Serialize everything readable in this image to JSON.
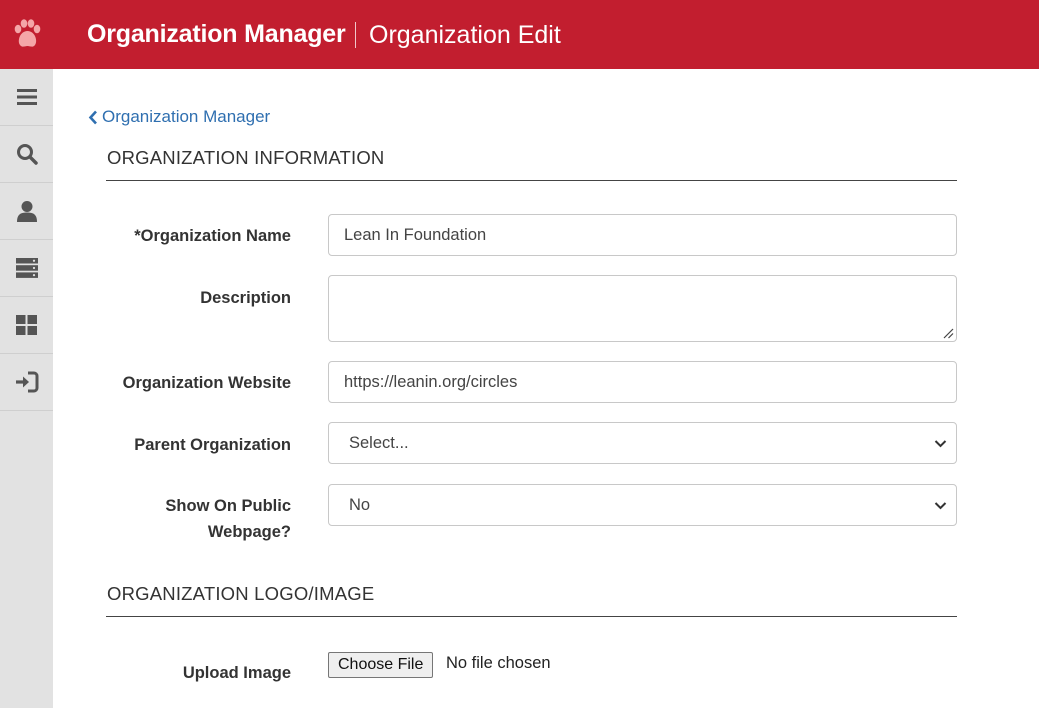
{
  "header": {
    "app_title": "Organization Manager",
    "page_title": "Organization Edit",
    "brand_color": "#c21e2f",
    "logo_icon": "paw-icon"
  },
  "sidebar": {
    "items": [
      {
        "icon": "menu-icon"
      },
      {
        "icon": "search-icon"
      },
      {
        "icon": "user-icon"
      },
      {
        "icon": "server-icon"
      },
      {
        "icon": "dashboard-icon"
      },
      {
        "icon": "sign-in-icon"
      }
    ]
  },
  "breadcrumb": {
    "back_label": "Organization Manager"
  },
  "sections": {
    "info_heading": "ORGANIZATION INFORMATION",
    "logo_heading": "ORGANIZATION LOGO/IMAGE"
  },
  "form": {
    "name_label": "*Organization Name",
    "name_value": "Lean In Foundation",
    "description_label": "Description",
    "description_value": "",
    "website_label": "Organization Website",
    "website_value": "https://leanin.org/circles",
    "parent_label": "Parent Organization",
    "parent_selected": "Select...",
    "public_label_line1": "Show On Public",
    "public_label_line2": "Webpage?",
    "public_selected": "No",
    "upload_label": "Upload Image",
    "file_button_label": "Choose File",
    "file_status": "No file chosen"
  }
}
